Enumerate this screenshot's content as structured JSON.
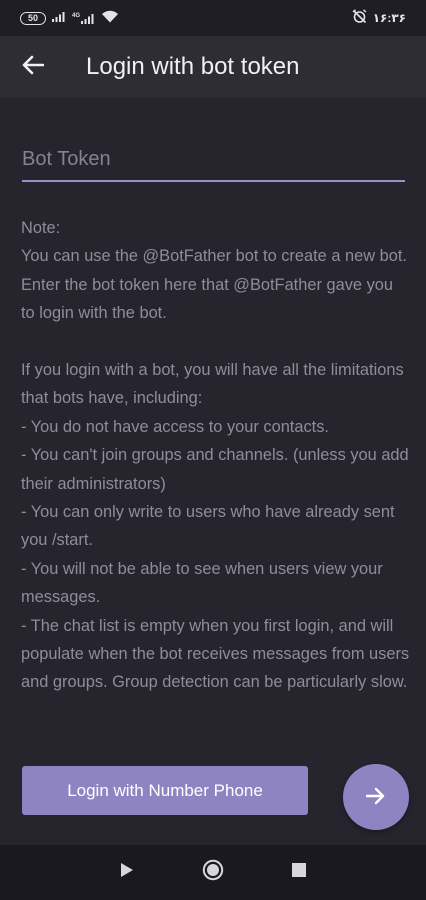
{
  "status_bar": {
    "battery": "50",
    "network": "4G",
    "time": "۱۶:۳۶"
  },
  "header": {
    "title": "Login with bot token"
  },
  "token_field": {
    "placeholder": "Bot Token",
    "value": ""
  },
  "note": {
    "paragraphs": [
      "Note:",
      "You can use the @BotFather bot to create a new bot.",
      "Enter the bot token here that @BotFather gave you to login with the bot.",
      "",
      "If you login with a bot, you will have all the limitations that bots have, including:",
      "- You do not have access to your contacts.",
      "- You can't join groups and channels. (unless you add their administrators)",
      "- You can only write to users who have already sent you /start.",
      "- You will not be able to see when users view your messages.",
      "- The chat list is empty when you first login, and will populate when the bot receives messages from users and groups. Group detection can be particularly slow."
    ]
  },
  "actions": {
    "login_phone_label": "Login with Number Phone"
  },
  "icons": {
    "back": "arrow-left-icon",
    "next": "arrow-right-icon",
    "nav_back": "play-triangle-icon",
    "nav_home": "circle-home-icon",
    "nav_recents": "square-recents-icon"
  },
  "colors": {
    "background": "#26242d",
    "app_bar": "#2e2c35",
    "accent": "#8f84c2",
    "underline": "#9a90cc"
  }
}
